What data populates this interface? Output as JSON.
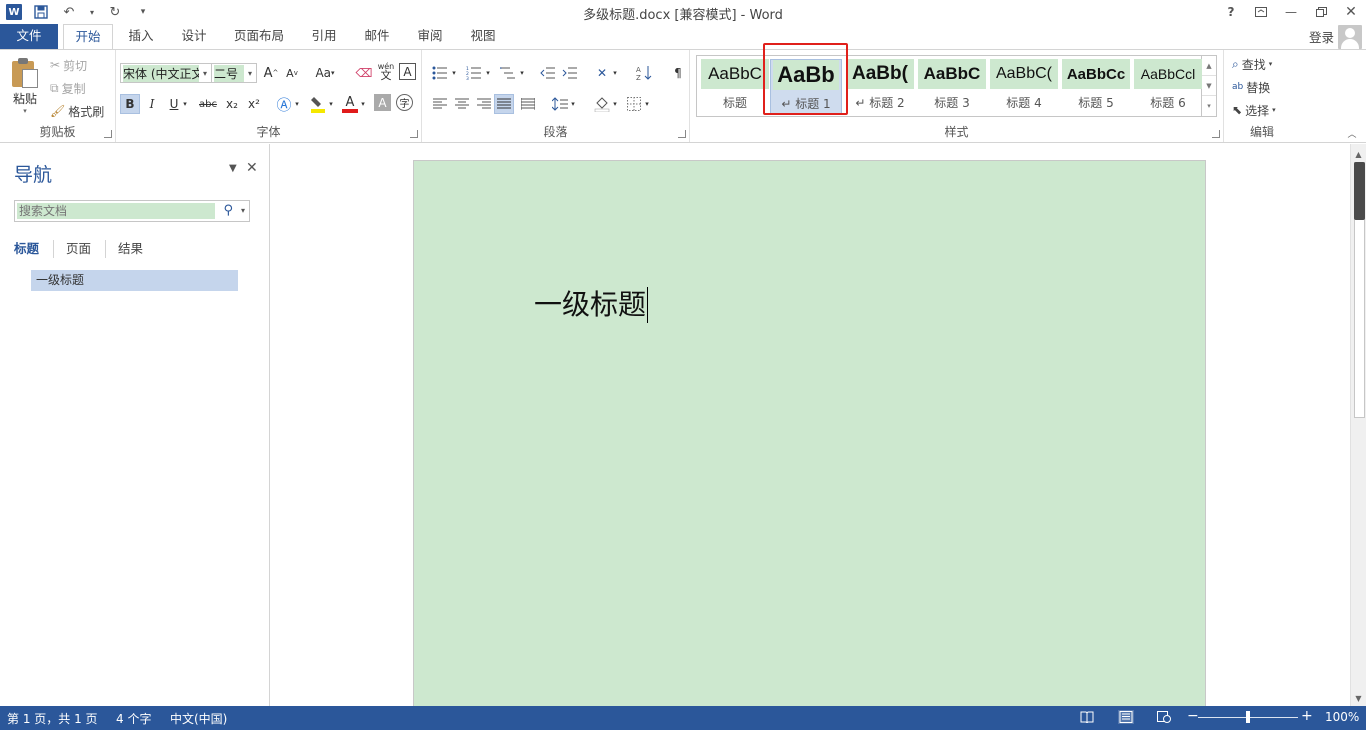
{
  "window": {
    "title": "多级标题.docx [兼容模式] - Word",
    "help": "?",
    "login": "登录"
  },
  "qat": {
    "more": "▾"
  },
  "tabs": [
    "文件",
    "开始",
    "插入",
    "设计",
    "页面布局",
    "引用",
    "邮件",
    "审阅",
    "视图"
  ],
  "ribbon": {
    "clipboard": {
      "label": "剪贴板",
      "paste": "粘贴",
      "cut": "剪切",
      "copy": "复制",
      "format_painter": "格式刷"
    },
    "font": {
      "label": "字体",
      "font_name": "宋体 (中文正文",
      "font_size": "二号",
      "bold": "B",
      "italic": "I",
      "underline": "U",
      "strike": "abc",
      "subscript": "x₂",
      "superscript": "x²",
      "change_case": "Aa",
      "grow": "A",
      "shrink": "A",
      "phonetic_top": "wén",
      "phonetic_bottom": "文",
      "border_char": "A",
      "shade_char": "A",
      "enclose": "字"
    },
    "paragraph": {
      "label": "段落"
    },
    "styles": {
      "label": "样式",
      "items": [
        {
          "sample": "AaBbC",
          "name": "标题"
        },
        {
          "sample": "AaBb",
          "name": "↵ 标题 1"
        },
        {
          "sample": "AaBb(",
          "name": "↵ 标题 2"
        },
        {
          "sample": "AaBbC",
          "name": "标题 3"
        },
        {
          "sample": "AaBbC(",
          "name": "标题 4"
        },
        {
          "sample": "AaBbCc",
          "name": "标题 5"
        },
        {
          "sample": "AaBbCcl",
          "name": "标题 6"
        }
      ],
      "selected_index": 1
    },
    "editing": {
      "label": "编辑",
      "find": "查找",
      "replace": "替换",
      "select": "选择"
    }
  },
  "nav": {
    "title": "导航",
    "search_placeholder": "搜索文档",
    "tabs": [
      "标题",
      "页面",
      "结果"
    ],
    "active_tab": 0,
    "headings": [
      "一级标题"
    ]
  },
  "document": {
    "text": "一级标题",
    "page_color": "#cde8cf"
  },
  "status": {
    "page": "第 1 页，共 1 页",
    "words": "4 个字",
    "language": "中文(中国)",
    "zoom": "100%",
    "zoom_minus": "−",
    "zoom_plus": "+"
  },
  "colors": {
    "accent": "#2b579a",
    "highlight_frame": "#e0201b",
    "selection": "#c5d5ec"
  }
}
